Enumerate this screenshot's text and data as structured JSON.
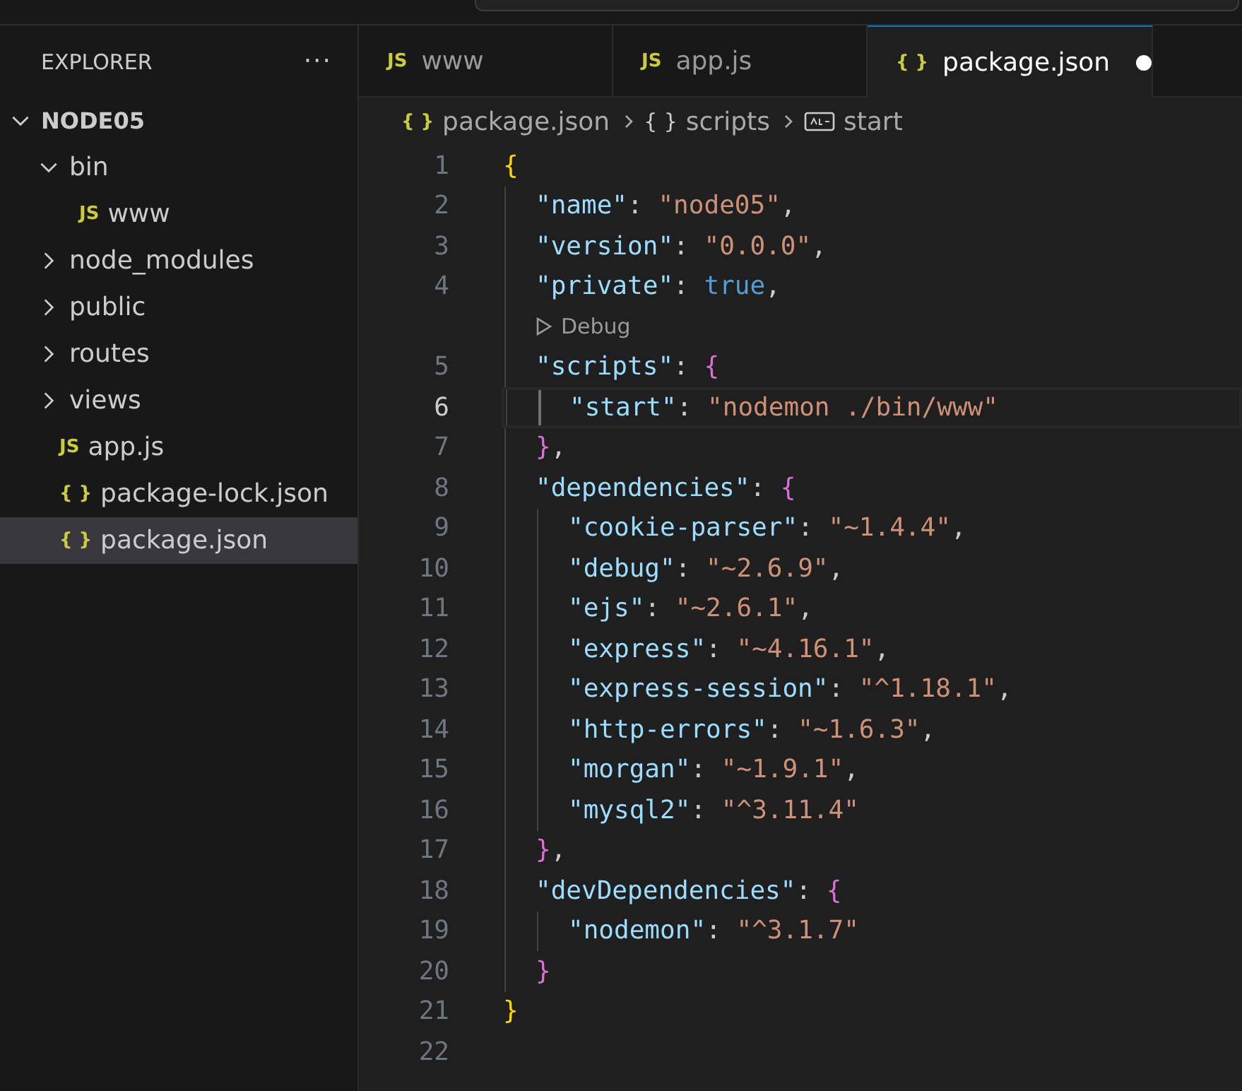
{
  "explorer": {
    "title": "EXPLORER",
    "more": "···"
  },
  "tree": [
    {
      "label": "NODE05",
      "kind": "root",
      "expanded": true,
      "selected": false,
      "children": [
        {
          "label": "bin",
          "kind": "folder",
          "expanded": true,
          "selected": false,
          "children": [
            {
              "label": "www",
              "kind": "file",
              "icon_text": "JS",
              "selected": false
            }
          ]
        },
        {
          "label": "node_modules",
          "kind": "folder",
          "expanded": false,
          "selected": false
        },
        {
          "label": "public",
          "kind": "folder",
          "expanded": false,
          "selected": false
        },
        {
          "label": "routes",
          "kind": "folder",
          "expanded": false,
          "selected": false
        },
        {
          "label": "views",
          "kind": "folder",
          "expanded": false,
          "selected": false
        },
        {
          "label": "app.js",
          "kind": "file",
          "icon_text": "JS",
          "selected": false
        },
        {
          "label": "package-lock.json",
          "kind": "file",
          "icon_text": "{ }",
          "selected": false
        },
        {
          "label": "package.json",
          "kind": "file",
          "icon_text": "{ }",
          "selected": true
        }
      ]
    }
  ],
  "tabs": [
    {
      "label": "www",
      "icon_text": "JS",
      "selected": false,
      "modified": false
    },
    {
      "label": "app.js",
      "icon_text": "JS",
      "selected": false,
      "modified": false
    },
    {
      "label": "package.json",
      "icon_text": "{ }",
      "selected": true,
      "modified": true
    }
  ],
  "breadcrumb": [
    {
      "label": "package.json",
      "kind": "file",
      "icon_text": "{ }"
    },
    {
      "label": "scripts",
      "kind": "object",
      "icon_text": "{ }"
    },
    {
      "label": "start",
      "kind": "string"
    }
  ],
  "lines": [
    {
      "kind": "code",
      "number": "1",
      "current": false,
      "tokens": [
        {
          "kind": "open",
          "text": "{"
        }
      ]
    },
    {
      "kind": "code",
      "number": "2",
      "current": false,
      "tokens": [
        {
          "kind": "key",
          "text": "\"name\""
        },
        {
          "kind": "p",
          "text": ": "
        },
        {
          "kind": "str",
          "text": "\"node05\""
        },
        {
          "kind": "p",
          "text": ","
        }
      ]
    },
    {
      "kind": "code",
      "number": "3",
      "current": false,
      "tokens": [
        {
          "kind": "key",
          "text": "\"version\""
        },
        {
          "kind": "p",
          "text": ": "
        },
        {
          "kind": "str",
          "text": "\"0.0.0\""
        },
        {
          "kind": "p",
          "text": ","
        }
      ]
    },
    {
      "kind": "code",
      "number": "4",
      "current": false,
      "tokens": [
        {
          "kind": "key",
          "text": "\"private\""
        },
        {
          "kind": "p",
          "text": ": "
        },
        {
          "kind": "bool",
          "text": "true"
        },
        {
          "kind": "p",
          "text": ","
        }
      ]
    },
    {
      "kind": "codelens",
      "text": "Debug"
    },
    {
      "kind": "code",
      "number": "5",
      "current": false,
      "tokens": [
        {
          "kind": "key",
          "text": "\"scripts\""
        },
        {
          "kind": "p",
          "text": ": "
        },
        {
          "kind": "open",
          "text": "{"
        }
      ]
    },
    {
      "kind": "code",
      "number": "6",
      "current": true,
      "tokens": [
        {
          "kind": "key",
          "text": "\"start\""
        },
        {
          "kind": "p",
          "text": ": "
        },
        {
          "kind": "str",
          "text": "\"nodemon ./bin/www\""
        }
      ]
    },
    {
      "kind": "code",
      "number": "7",
      "current": false,
      "tokens": [
        {
          "kind": "close",
          "text": "}"
        },
        {
          "kind": "p",
          "text": ","
        }
      ]
    },
    {
      "kind": "code",
      "number": "8",
      "current": false,
      "tokens": [
        {
          "kind": "key",
          "text": "\"dependencies\""
        },
        {
          "kind": "p",
          "text": ": "
        },
        {
          "kind": "open",
          "text": "{"
        }
      ]
    },
    {
      "kind": "code",
      "number": "9",
      "current": false,
      "tokens": [
        {
          "kind": "key",
          "text": "\"cookie-parser\""
        },
        {
          "kind": "p",
          "text": ": "
        },
        {
          "kind": "str",
          "text": "\"~1.4.4\""
        },
        {
          "kind": "p",
          "text": ","
        }
      ]
    },
    {
      "kind": "code",
      "number": "10",
      "current": false,
      "tokens": [
        {
          "kind": "key",
          "text": "\"debug\""
        },
        {
          "kind": "p",
          "text": ": "
        },
        {
          "kind": "str",
          "text": "\"~2.6.9\""
        },
        {
          "kind": "p",
          "text": ","
        }
      ]
    },
    {
      "kind": "code",
      "number": "11",
      "current": false,
      "tokens": [
        {
          "kind": "key",
          "text": "\"ejs\""
        },
        {
          "kind": "p",
          "text": ": "
        },
        {
          "kind": "str",
          "text": "\"~2.6.1\""
        },
        {
          "kind": "p",
          "text": ","
        }
      ]
    },
    {
      "kind": "code",
      "number": "12",
      "current": false,
      "tokens": [
        {
          "kind": "key",
          "text": "\"express\""
        },
        {
          "kind": "p",
          "text": ": "
        },
        {
          "kind": "str",
          "text": "\"~4.16.1\""
        },
        {
          "kind": "p",
          "text": ","
        }
      ]
    },
    {
      "kind": "code",
      "number": "13",
      "current": false,
      "tokens": [
        {
          "kind": "key",
          "text": "\"express-session\""
        },
        {
          "kind": "p",
          "text": ": "
        },
        {
          "kind": "str",
          "text": "\"^1.18.1\""
        },
        {
          "kind": "p",
          "text": ","
        }
      ]
    },
    {
      "kind": "code",
      "number": "14",
      "current": false,
      "tokens": [
        {
          "kind": "key",
          "text": "\"http-errors\""
        },
        {
          "kind": "p",
          "text": ": "
        },
        {
          "kind": "str",
          "text": "\"~1.6.3\""
        },
        {
          "kind": "p",
          "text": ","
        }
      ]
    },
    {
      "kind": "code",
      "number": "15",
      "current": false,
      "tokens": [
        {
          "kind": "key",
          "text": "\"morgan\""
        },
        {
          "kind": "p",
          "text": ": "
        },
        {
          "kind": "str",
          "text": "\"~1.9.1\""
        },
        {
          "kind": "p",
          "text": ","
        }
      ]
    },
    {
      "kind": "code",
      "number": "16",
      "current": false,
      "tokens": [
        {
          "kind": "key",
          "text": "\"mysql2\""
        },
        {
          "kind": "p",
          "text": ": "
        },
        {
          "kind": "str",
          "text": "\"^3.11.4\""
        }
      ]
    },
    {
      "kind": "code",
      "number": "17",
      "current": false,
      "tokens": [
        {
          "kind": "close",
          "text": "}"
        },
        {
          "kind": "p",
          "text": ","
        }
      ]
    },
    {
      "kind": "code",
      "number": "18",
      "current": false,
      "tokens": [
        {
          "kind": "key",
          "text": "\"devDependencies\""
        },
        {
          "kind": "p",
          "text": ": "
        },
        {
          "kind": "open",
          "text": "{"
        }
      ]
    },
    {
      "kind": "code",
      "number": "19",
      "current": false,
      "tokens": [
        {
          "kind": "key",
          "text": "\"nodemon\""
        },
        {
          "kind": "p",
          "text": ": "
        },
        {
          "kind": "str",
          "text": "\"^3.1.7\""
        }
      ]
    },
    {
      "kind": "code",
      "number": "20",
      "current": false,
      "tokens": [
        {
          "kind": "close",
          "text": "}"
        }
      ]
    },
    {
      "kind": "code",
      "number": "21",
      "current": false,
      "tokens": [
        {
          "kind": "close",
          "text": "}"
        }
      ]
    },
    {
      "kind": "code",
      "number": "22",
      "current": false
    }
  ]
}
